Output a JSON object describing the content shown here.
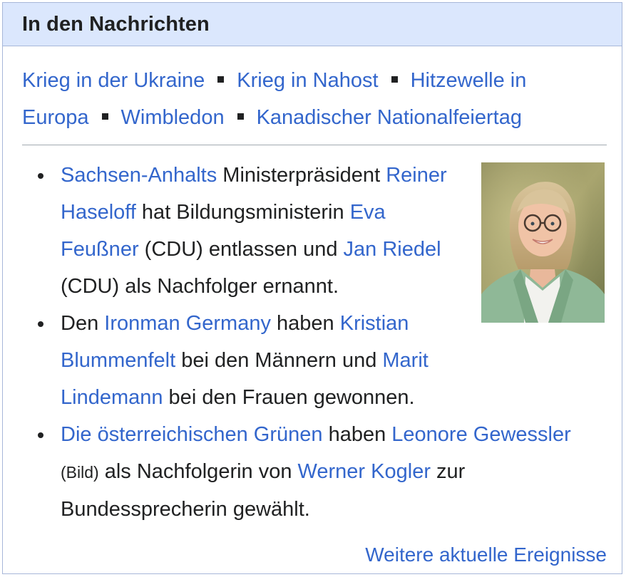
{
  "box": {
    "title": "In den Nachrichten"
  },
  "topics": [
    "Krieg in der Ukraine",
    "Krieg in Nahost",
    "Hitzewelle in Europa",
    "Wimbledon",
    "Kanadischer Nationalfeiertag"
  ],
  "news": {
    "item1": {
      "l1": "Sachsen-Anhalts",
      "t1": " Ministerpräsident ",
      "l2": "Reiner Haseloff",
      "t2": " hat Bildungsministerin ",
      "l3": "Eva Feußner",
      "t3": " (CDU) entlassen und ",
      "l4": "Jan Riedel",
      "t4": " (CDU) als Nachfolger ernannt."
    },
    "item2": {
      "t0": "Den ",
      "l1": "Ironman Germany",
      "t1": " haben ",
      "l2": "Kristian Blummenfelt",
      "t2": " bei den Männern und ",
      "l3": "Marit Lindemann",
      "t3": " bei den Frauen gewonnen."
    },
    "item3": {
      "l1": "Die österreichischen Grünen",
      "t1": " haben ",
      "l2": "Leonore Gewessler",
      "small": "(Bild)",
      "t2": " als Nachfolgerin von ",
      "l3": "Werner Kogler",
      "t3": " zur Bundessprecherin gewählt."
    }
  },
  "more_link": "Weitere aktuelle Ereignisse",
  "colors": {
    "link": "#3366cc",
    "text": "#202122",
    "header_bg": "#dbe7fd",
    "border": "#a7b7d9"
  },
  "image": {
    "icon": "portrait-photo"
  }
}
